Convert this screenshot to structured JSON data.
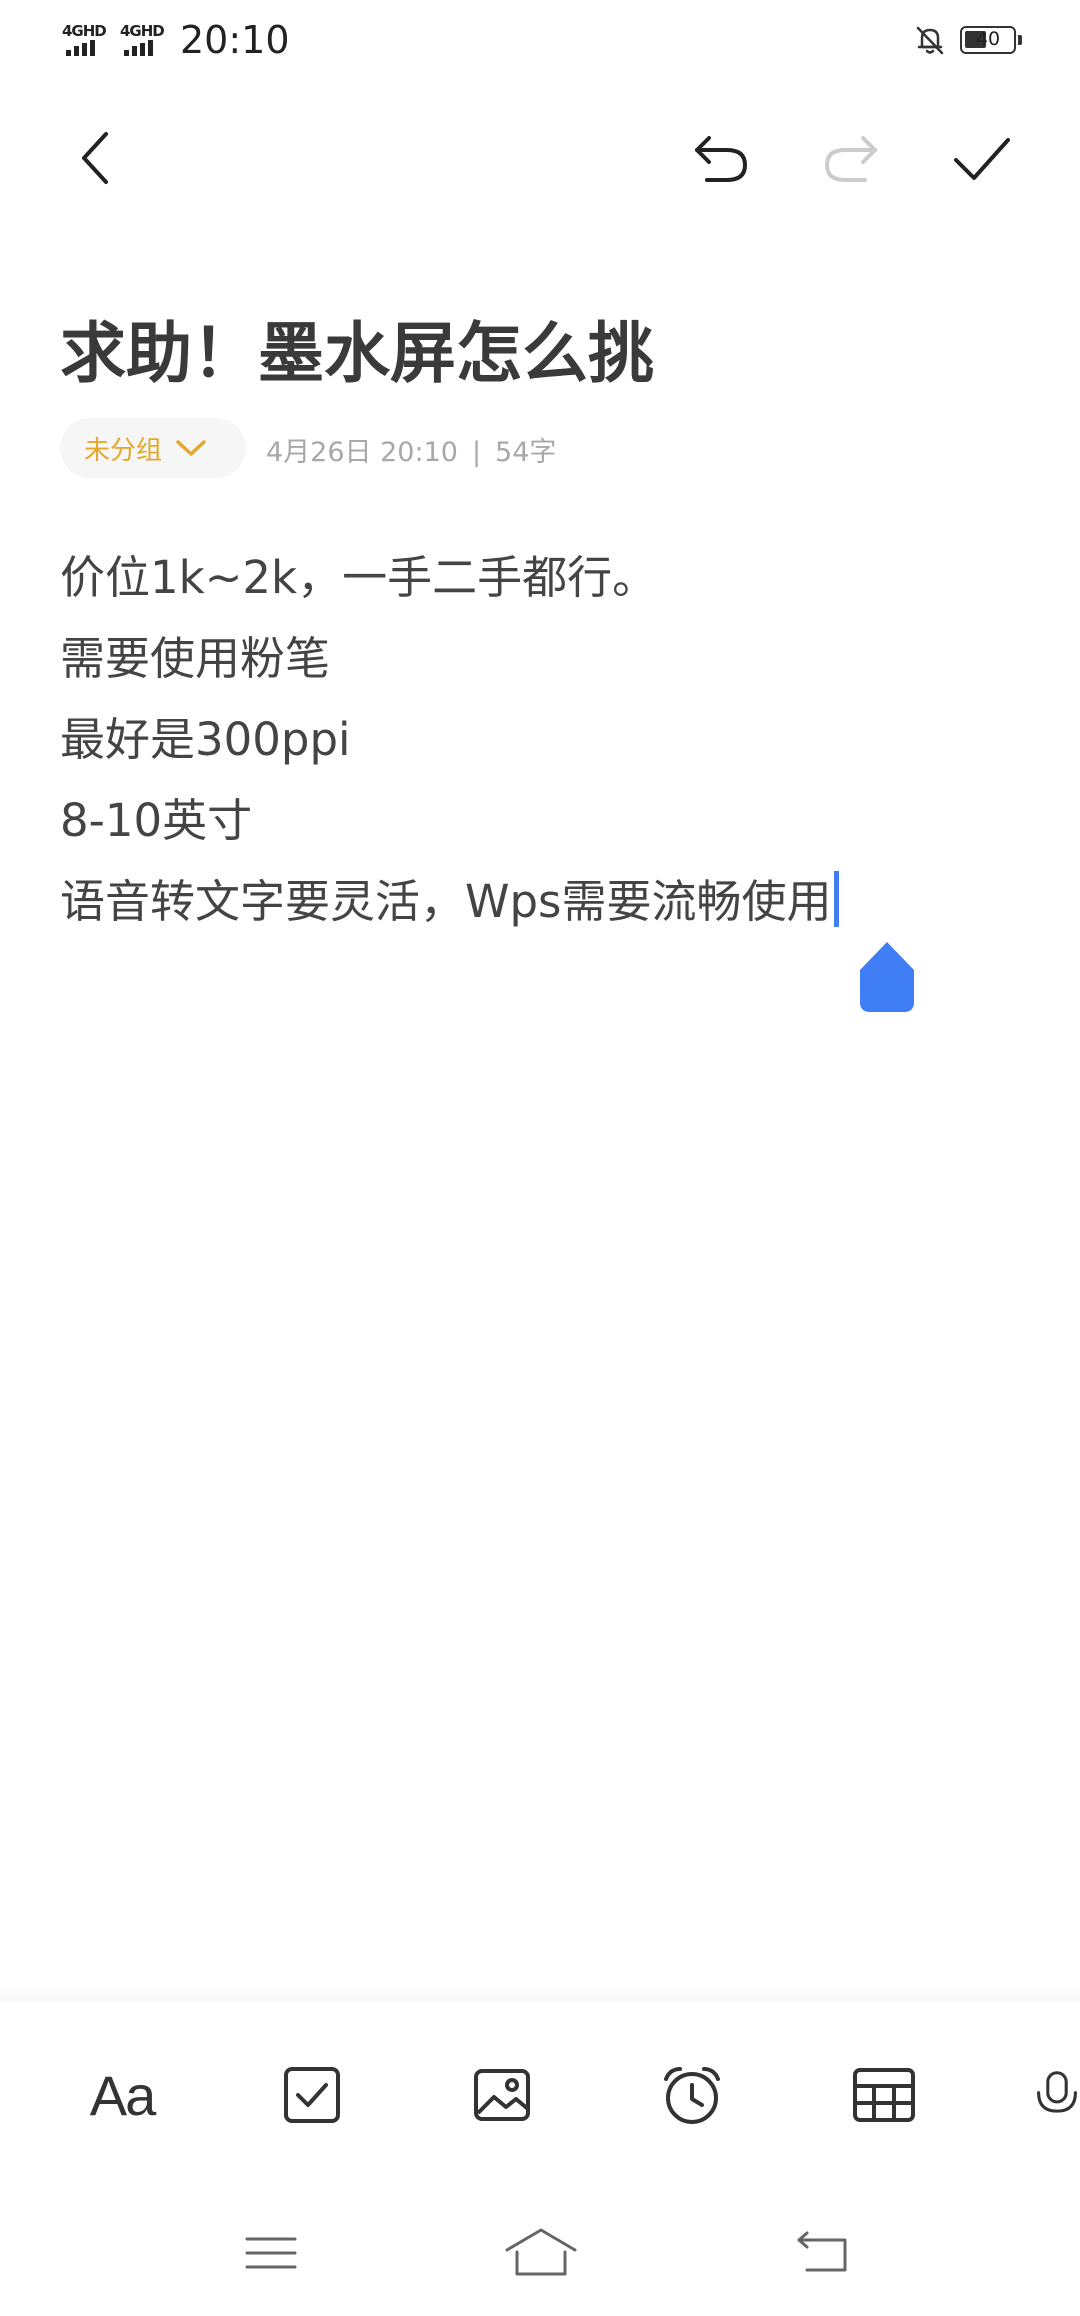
{
  "status_bar": {
    "sim1_label": "4GHD",
    "sim2_label": "4GHD",
    "time": "20:10",
    "battery_level": "40"
  },
  "toolbar": {
    "back_icon": "chevron-left-icon",
    "undo_icon": "undo-icon",
    "redo_icon": "redo-icon",
    "redo_enabled": false,
    "done_icon": "check-icon"
  },
  "note": {
    "title": "求助！墨水屏怎么挑",
    "group_label": "未分组",
    "date": "4月26日 20:10",
    "separator": "|",
    "char_count": "54字",
    "lines": [
      "价位1k~2k，一手二手都行。",
      "需要使用粉笔",
      "最好是300ppi",
      "8-10英寸",
      "语音转文字要灵活，Wps需要流畅使用"
    ]
  },
  "bottom_tools": [
    {
      "label": "Aa",
      "icon": "text-format-icon"
    },
    {
      "icon": "checkbox-icon"
    },
    {
      "icon": "image-icon"
    },
    {
      "icon": "alarm-clock-icon"
    },
    {
      "icon": "table-icon"
    },
    {
      "icon": "microphone-icon"
    }
  ],
  "colors": {
    "accent": "#3f7ef5",
    "group_label": "#e4a82b",
    "meta_text": "#a8a8a8",
    "body_text": "#444444"
  }
}
